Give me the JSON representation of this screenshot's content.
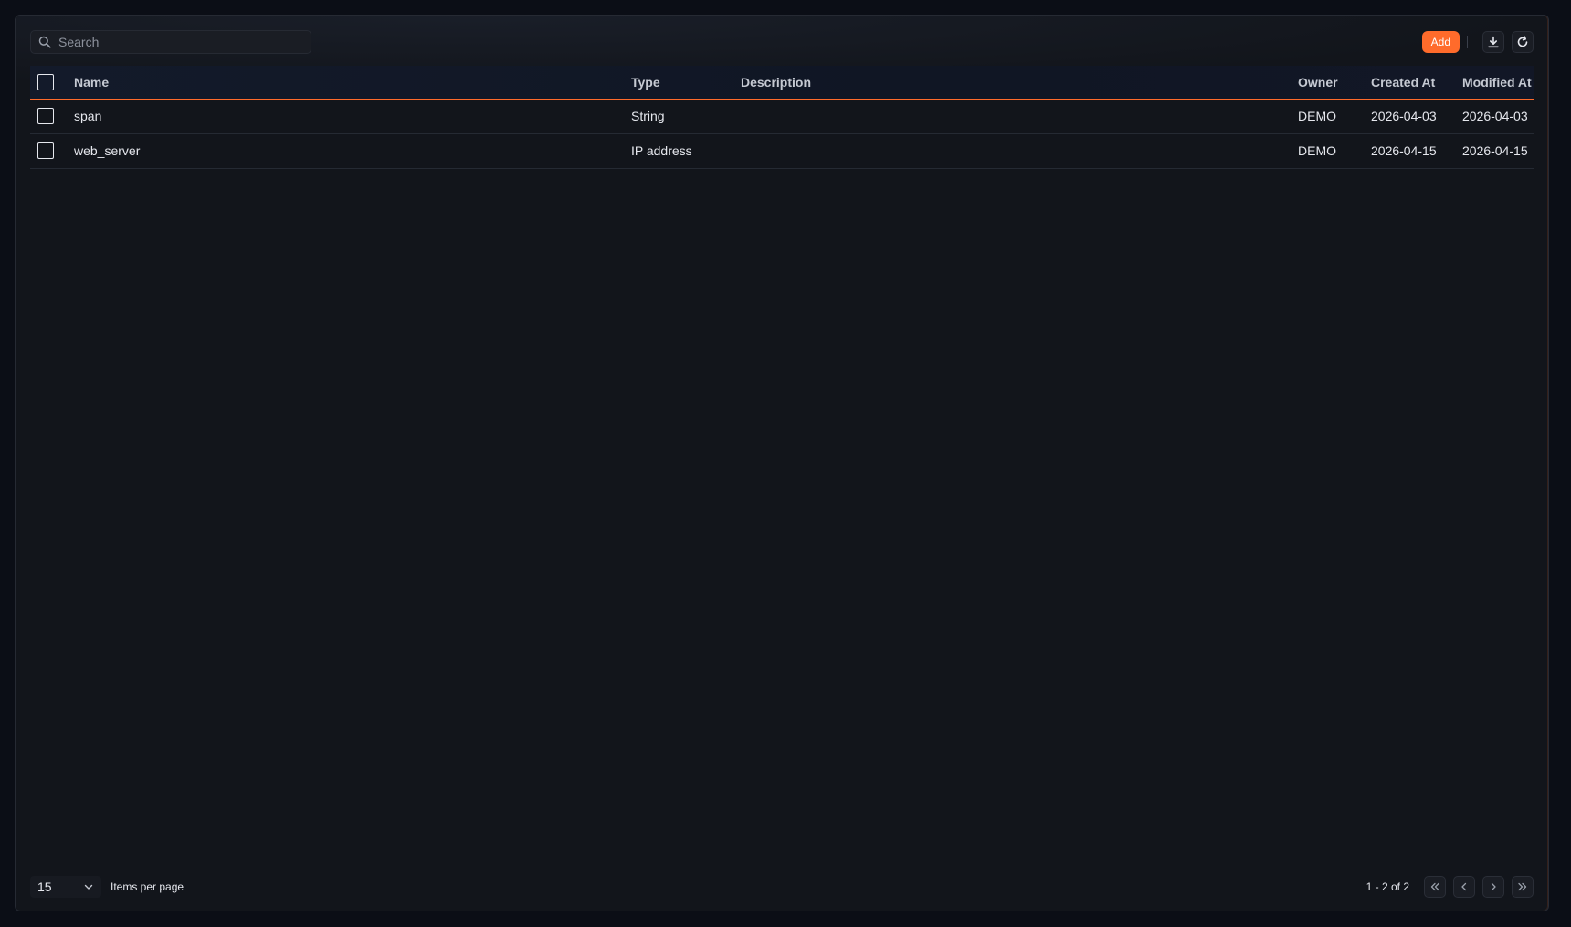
{
  "search": {
    "placeholder": "Search",
    "value": ""
  },
  "toolbar": {
    "add_label": "Add",
    "download_icon": "download-icon",
    "refresh_icon": "refresh-icon"
  },
  "colors": {
    "accent": "#ff6b2b",
    "background": "#0b0e16",
    "panel": "#12151b"
  },
  "table": {
    "headers": {
      "name": "Name",
      "type": "Type",
      "description": "Description",
      "owner": "Owner",
      "created_at": "Created At",
      "modified_at": "Modified At"
    },
    "rows": [
      {
        "name": "span",
        "type": "String",
        "description": "",
        "owner": "DEMO",
        "created_at": "2026-04-03",
        "modified_at": "2026-04-03"
      },
      {
        "name": "web_server",
        "type": "IP address",
        "description": "",
        "owner": "DEMO",
        "created_at": "2026-04-15",
        "modified_at": "2026-04-15"
      }
    ]
  },
  "pagination": {
    "per_page": "15",
    "per_page_label": "Items per page",
    "range": "1 - 2 of 2"
  }
}
